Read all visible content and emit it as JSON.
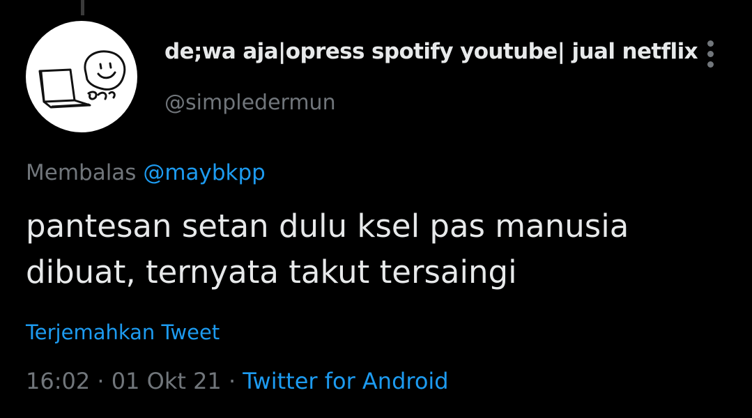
{
  "tweet": {
    "author": {
      "display_name": "de;wa aja|opress spotify youtube| jual netflix",
      "handle": "@simpledermun",
      "avatar_icon": "doodle-laptop-smiley-avatar"
    },
    "reply_context": {
      "prefix": "Membalas",
      "mention": "@maybkpp"
    },
    "text": "pantesan setan dulu ksel pas manusia\ndibuat, ternyata takut tersaingi",
    "translate_label": "Terjemahkan Tweet",
    "meta": {
      "time": "16:02",
      "separator": " · ",
      "date": "01 Okt 21",
      "source": "Twitter for Android"
    },
    "more_icon": "vertical-ellipsis-icon"
  },
  "colors": {
    "background": "#000000",
    "primary_text": "#e7e9ea",
    "secondary_text": "#71767b",
    "accent": "#1d9bf0"
  }
}
